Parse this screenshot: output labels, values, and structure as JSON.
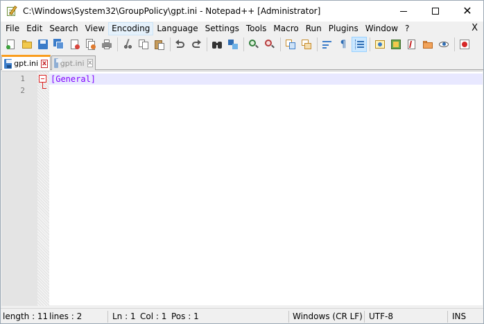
{
  "window": {
    "title": "C:\\Windows\\System32\\GroupPolicy\\gpt.ini - Notepad++ [Administrator]",
    "minimize_glyph": "",
    "close_glyph": "✕"
  },
  "menu": {
    "items": [
      "File",
      "Edit",
      "Search",
      "View",
      "Encoding",
      "Language",
      "Settings",
      "Tools",
      "Macro",
      "Run",
      "Plugins",
      "Window",
      "?"
    ],
    "hovered": "Encoding",
    "close_glyph": "X"
  },
  "toolbar": {
    "buttons": [
      "new-file",
      "open-file",
      "save",
      "save-all",
      "close",
      "close-all",
      "print",
      "cut",
      "copy",
      "paste",
      "undo",
      "redo",
      "find",
      "replace",
      "zoom-in",
      "zoom-out",
      "sync-vertical",
      "sync-horizontal",
      "word-wrap",
      "show-all-chars",
      "indent-guide",
      "user-language",
      "document-map",
      "function-list",
      "folder-workspace",
      "monitoring",
      "record-macro"
    ],
    "active": [
      "indent-guide"
    ]
  },
  "tabs": [
    {
      "label": "gpt.ini",
      "active": true,
      "close_glyph": "x"
    },
    {
      "label": "gpt.ini",
      "active": false,
      "close_glyph": "x"
    }
  ],
  "editor": {
    "line_numbers": [
      "1",
      "2"
    ],
    "lines": [
      "[General]",
      ""
    ]
  },
  "status": {
    "length": "length : 11",
    "lines": "lines : 2",
    "ln": "Ln : 1",
    "col": "Col : 1",
    "pos": "Pos : 1",
    "eol": "Windows (CR LF)",
    "encoding": "UTF-8",
    "mode": "INS"
  },
  "colors": {
    "tab_accent": "#fa9d1d",
    "section_text": "#8000ff",
    "caret_line": "#e8e8ff",
    "fold_marker": "#dd2222"
  }
}
